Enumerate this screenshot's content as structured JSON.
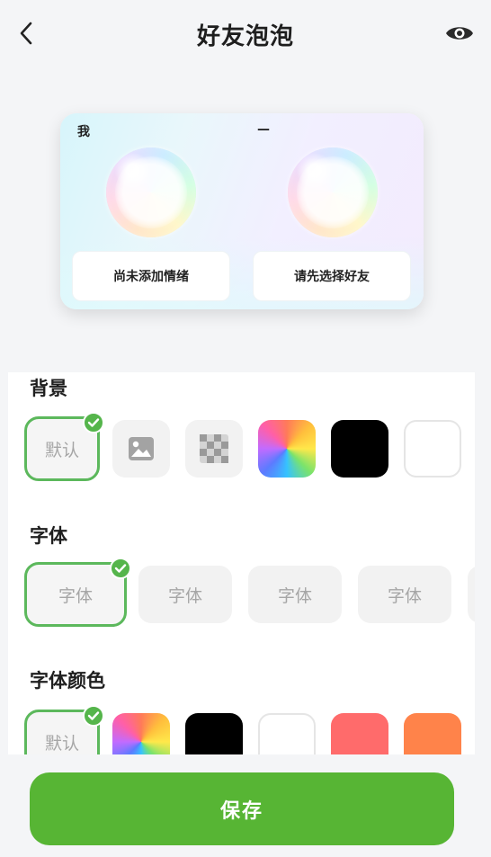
{
  "header": {
    "title": "好友泡泡",
    "back_icon": "chevron-left-icon",
    "preview_icon": "eye-icon"
  },
  "preview": {
    "left_label": "我",
    "right_label": "—",
    "left_pill": "尚未添加情绪",
    "right_pill": "请先选择好友"
  },
  "background_section": {
    "title": "背景",
    "options": [
      {
        "label": "默认",
        "selected": true
      },
      {
        "icon": "image-icon"
      },
      {
        "icon": "transparent-grid-icon"
      },
      {
        "swatch": "rainbow"
      },
      {
        "swatch": "#000000"
      },
      {
        "swatch": "#ffffff"
      }
    ]
  },
  "font_section": {
    "title": "字体",
    "options": [
      {
        "label": "字体",
        "selected": true
      },
      {
        "label": "字体"
      },
      {
        "label": "字体"
      },
      {
        "label": "字体"
      }
    ]
  },
  "font_color_section": {
    "title": "字体颜色",
    "options": [
      {
        "label": "默认",
        "selected": true
      },
      {
        "swatch": "rainbow"
      },
      {
        "swatch": "#000000"
      },
      {
        "swatch": "#ffffff"
      },
      {
        "swatch": "#ff6b6b"
      },
      {
        "swatch": "#ff834a"
      }
    ]
  },
  "save_button": {
    "label": "保存"
  },
  "colors": {
    "accent": "#57b534",
    "check": "#55b54b"
  }
}
